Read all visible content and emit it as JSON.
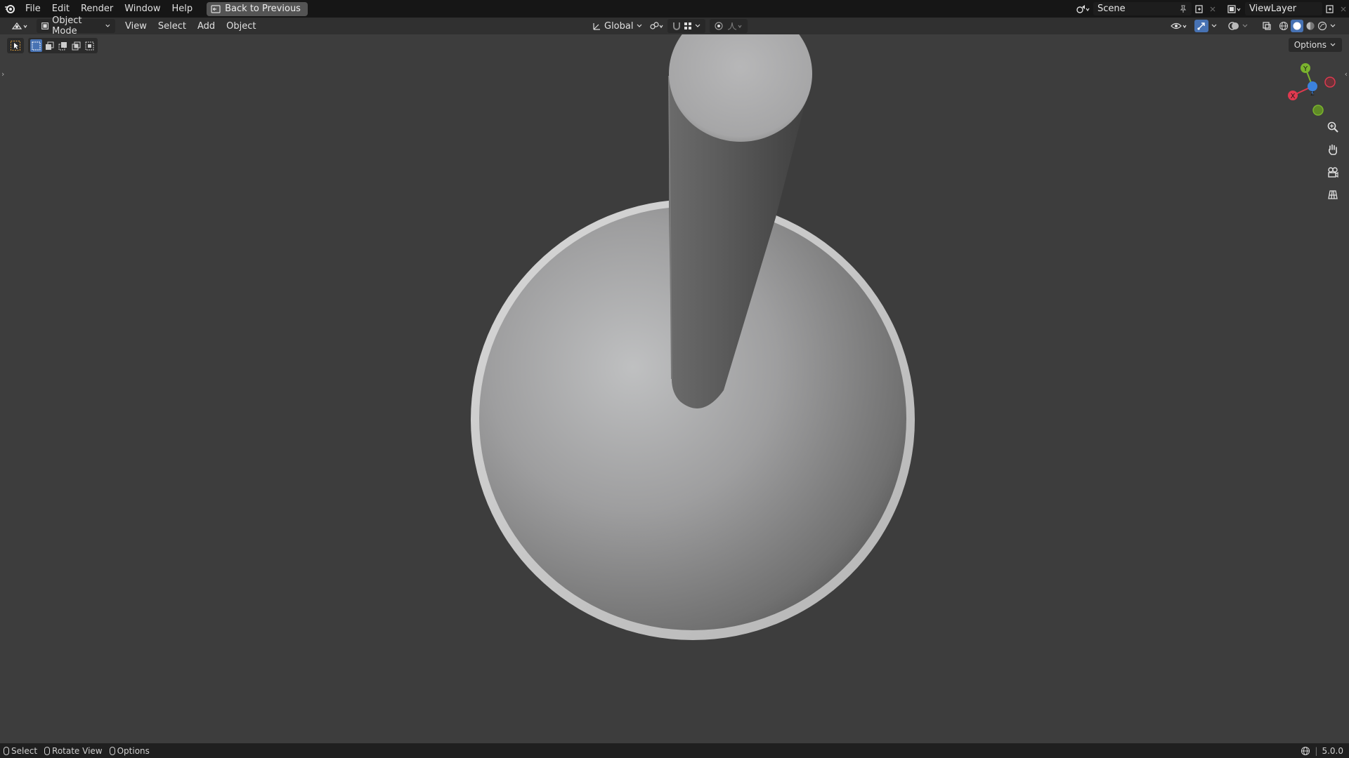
{
  "menubar": {
    "items": [
      "File",
      "Edit",
      "Render",
      "Window",
      "Help"
    ],
    "back_button": "Back to Previous",
    "scene_name": "Scene",
    "view_layer_name": "ViewLayer"
  },
  "header": {
    "mode": "Object Mode",
    "menus": [
      "View",
      "Select",
      "Add",
      "Object"
    ],
    "transform_orientation": "Global"
  },
  "viewport": {
    "options_label": "Options",
    "gizmo_axes": [
      "Y",
      "X",
      "Z"
    ],
    "colors": {
      "background": "#3d3d3d",
      "axis_x": "#e0394f",
      "axis_y": "#7ab32d",
      "axis_z": "#3c82dc",
      "active_tool": "#4772b3"
    }
  },
  "statusbar": {
    "items": [
      "Select",
      "Rotate View",
      "Options"
    ],
    "version": "5.0.0"
  }
}
